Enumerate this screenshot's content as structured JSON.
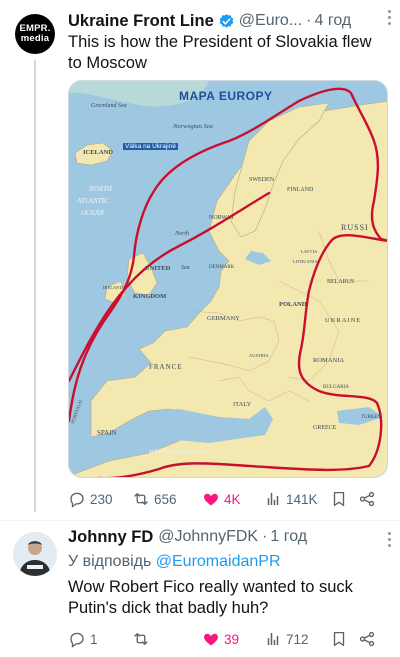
{
  "post": {
    "avatar_text_1": "EMPR.",
    "avatar_text_2": "media",
    "author": "Ukraine Front Line",
    "handle": "@Euro...",
    "separator": "·",
    "time": "4 год",
    "text": "This is how the President of Slovakia flew to Moscow",
    "map": {
      "title": "MAPA EUROPY",
      "labels": {
        "greenland": "Greenland Sea",
        "norwegian": "Norwegian Sea",
        "iceland": "ICELAND",
        "war": "Válka na Ukrajině",
        "north_atlantic_1": "NORTH",
        "north_atlantic_2": "ATLANTIC",
        "north_atlantic_3": "OCEAN",
        "sweden": "SWEDEN",
        "finland": "FINLAND",
        "norway": "NORWAY",
        "russia": "RUSSI",
        "north_sea_1": "North",
        "north_sea_2": "Sea",
        "united": "UNITED",
        "kingdom": "KINGDOM",
        "denmark": "DENMARK",
        "lithuania": "LITHUANIA",
        "latvia": "LATVIA",
        "belarus": "BELARUS",
        "ireland": "IRELAND",
        "poland": "POLAND",
        "germany": "GERMANY",
        "ukraine": "UKRAINE",
        "france": "FRANCE",
        "romania": "ROMANIA",
        "austria": "AUSTRIA",
        "italy": "ITALY",
        "bulgaria": "BULGARIA",
        "spain": "SPAIN",
        "portugal": "PORTUGAL",
        "greece": "GREECE",
        "turkey": "TURKEY",
        "med_sea": "MEDITERRANEAN SEA"
      }
    },
    "stats": {
      "replies": "230",
      "reposts": "656",
      "likes": "4K",
      "views": "141K"
    }
  },
  "reply": {
    "author": "Johnny FD",
    "handle": "@JohnnyFDK",
    "separator": "·",
    "time": "1 год",
    "reply_prefix": "У відповідь",
    "reply_to": "@EuromaidanPR",
    "text": "Wow Robert Fico really wanted to suck Putin's dick that badly huh?",
    "stats": {
      "replies": "1",
      "reposts": "",
      "likes": "39",
      "views": "712"
    }
  },
  "colors": {
    "like": "#f91880",
    "link": "#1d9bf0",
    "route": "#c8102e",
    "verified": "#1d9bf0"
  }
}
